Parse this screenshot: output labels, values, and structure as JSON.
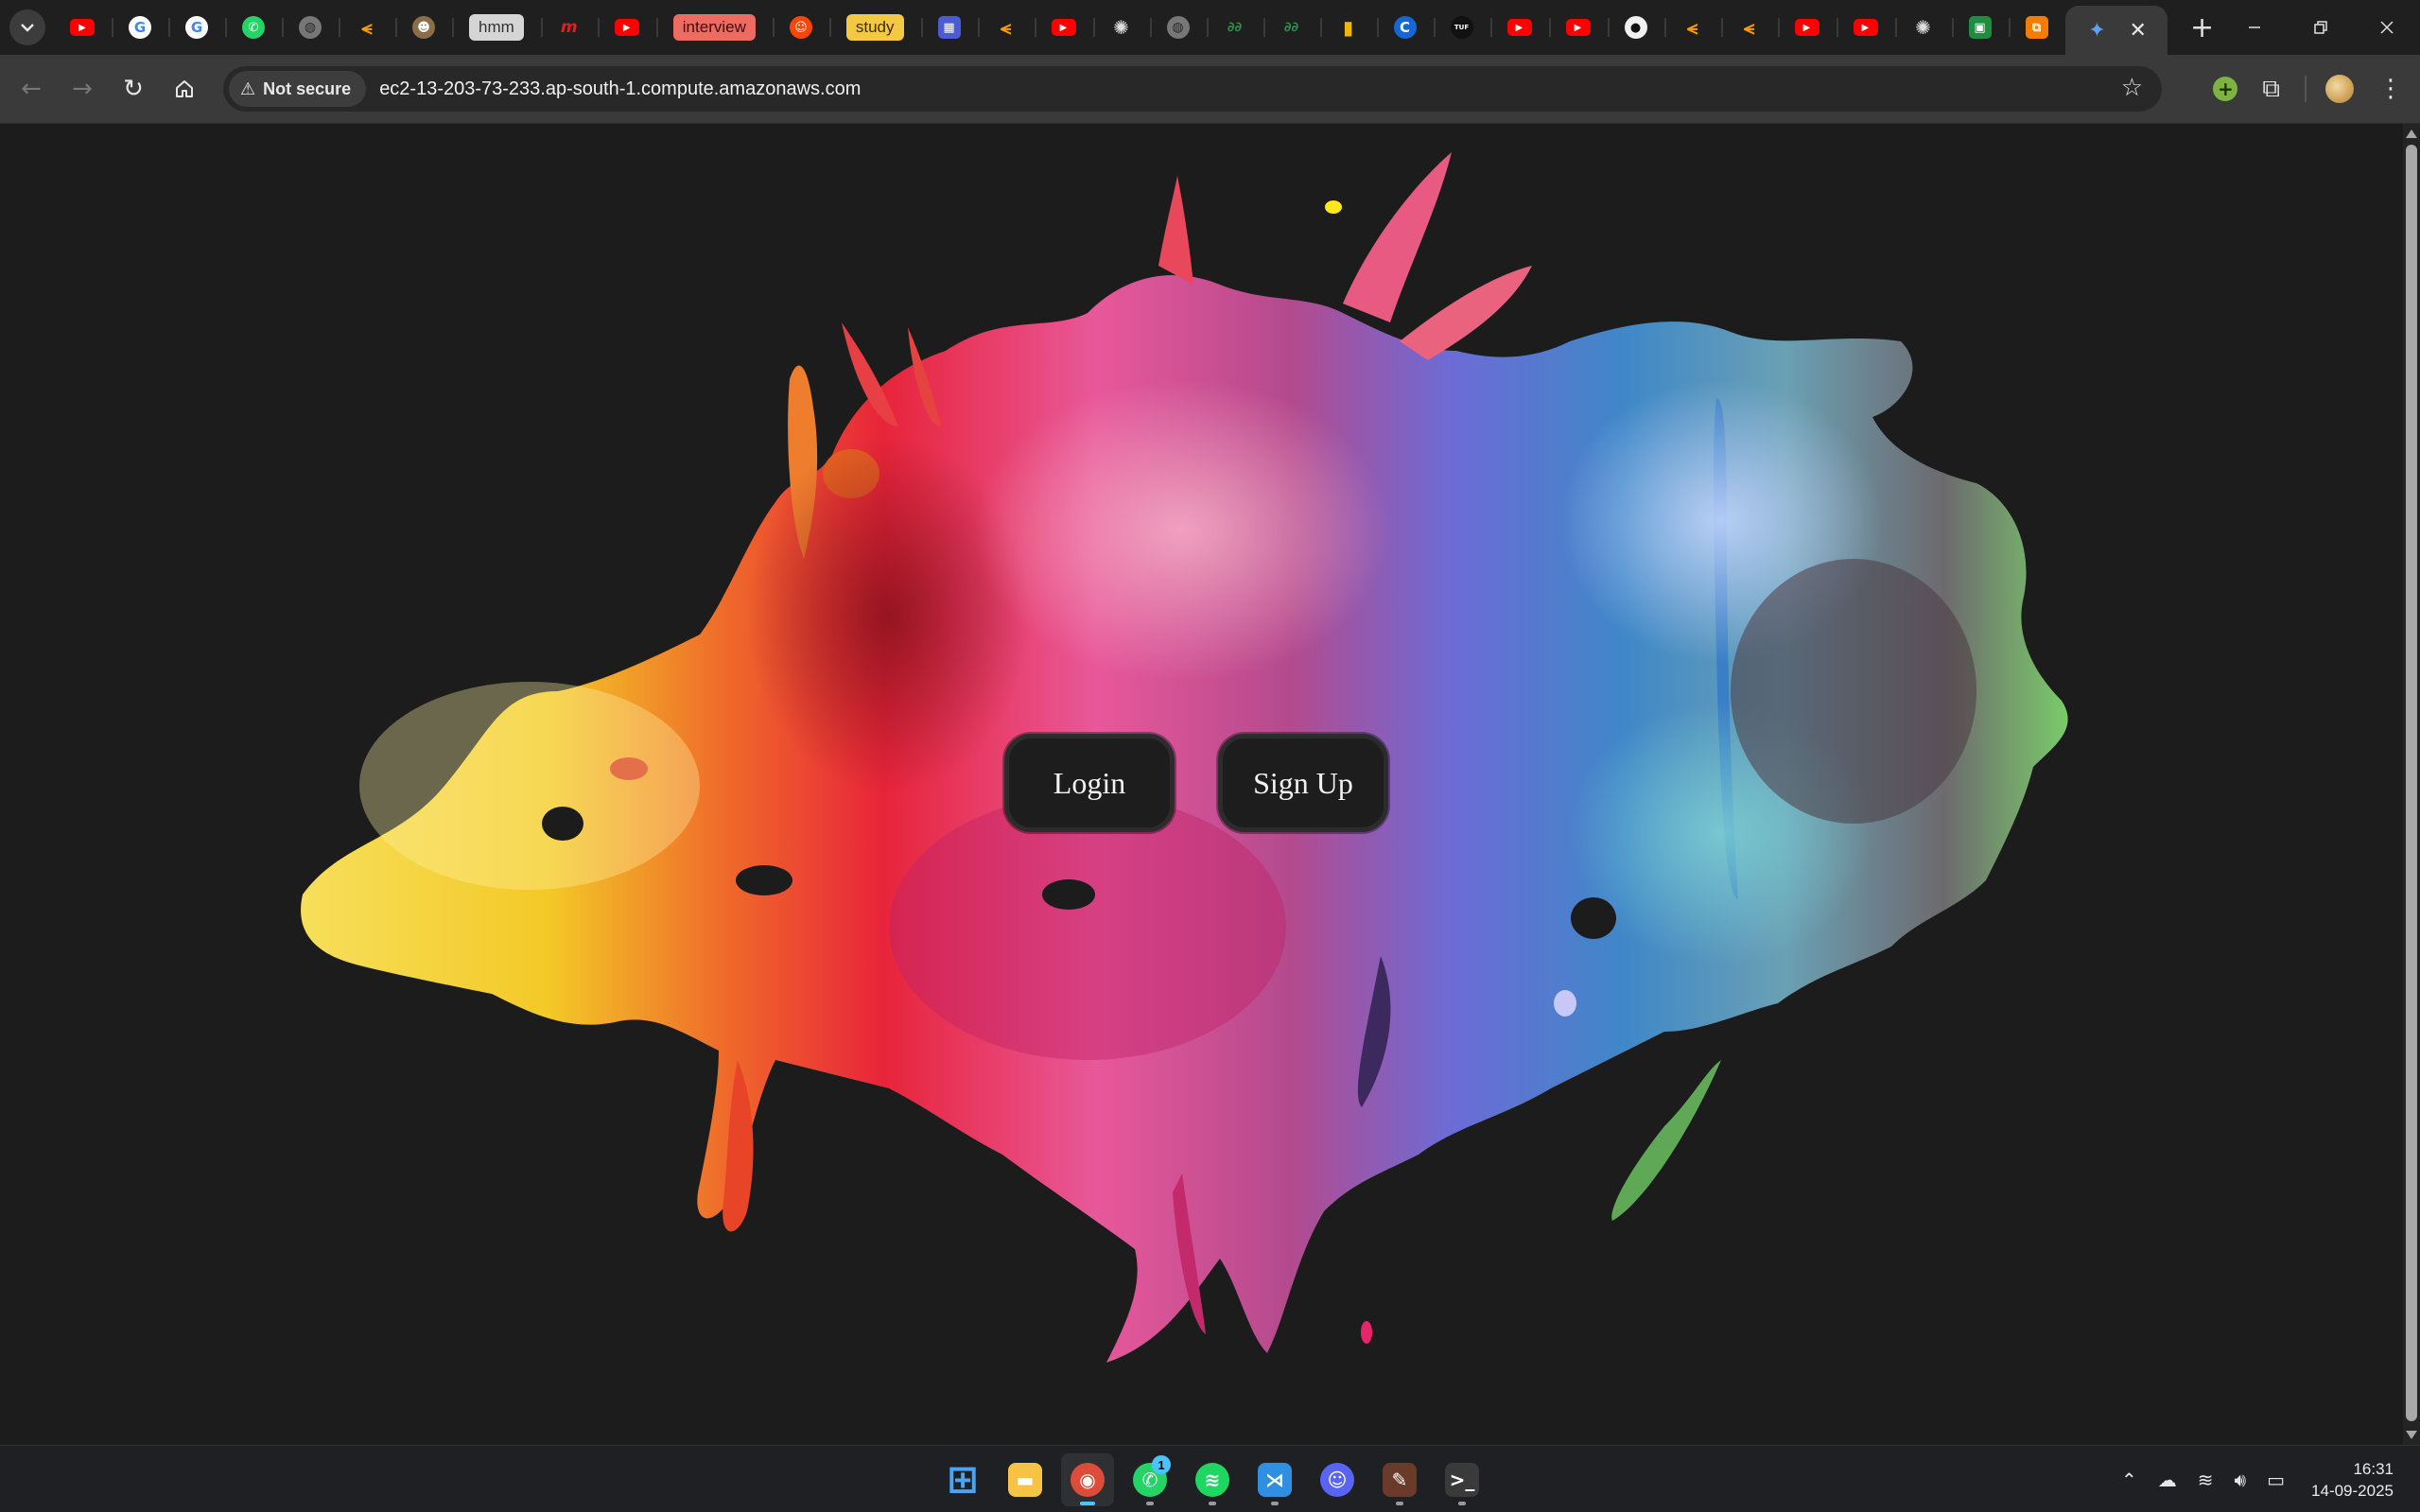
{
  "browser": {
    "tabs": [
      {
        "kind": "icon",
        "icon": "youtube-icon"
      },
      {
        "kind": "icon",
        "icon": "google-icon"
      },
      {
        "kind": "icon",
        "icon": "google-icon"
      },
      {
        "kind": "icon",
        "icon": "whatsapp-icon"
      },
      {
        "kind": "icon",
        "icon": "globe-icon"
      },
      {
        "kind": "icon",
        "icon": "amazon-icon"
      },
      {
        "kind": "icon",
        "icon": "monkey-icon"
      },
      {
        "kind": "chip",
        "label": "hmm",
        "color": "#d5d5d5"
      },
      {
        "kind": "icon",
        "icon": "myntra-icon"
      },
      {
        "kind": "icon",
        "icon": "youtube-icon"
      },
      {
        "kind": "chip",
        "label": "interview",
        "color": "#ee6b61"
      },
      {
        "kind": "icon",
        "icon": "reddit-icon"
      },
      {
        "kind": "chip",
        "label": "study",
        "color": "#f3c843"
      },
      {
        "kind": "icon",
        "icon": "board-icon"
      },
      {
        "kind": "icon",
        "icon": "amazon-icon"
      },
      {
        "kind": "icon",
        "icon": "youtube-icon"
      },
      {
        "kind": "icon",
        "icon": "openai-icon"
      },
      {
        "kind": "icon",
        "icon": "globe-icon"
      },
      {
        "kind": "icon",
        "icon": "geeksforgeeks-icon"
      },
      {
        "kind": "icon",
        "icon": "geeksforgeeks-icon"
      },
      {
        "kind": "icon",
        "icon": "bar-chart-icon"
      },
      {
        "kind": "icon",
        "icon": "c-icon"
      },
      {
        "kind": "icon",
        "icon": "tuf-icon"
      },
      {
        "kind": "icon",
        "icon": "youtube-icon"
      },
      {
        "kind": "icon",
        "icon": "youtube-icon"
      },
      {
        "kind": "icon",
        "icon": "github-icon"
      },
      {
        "kind": "icon",
        "icon": "amazon-icon"
      },
      {
        "kind": "icon",
        "icon": "amazon-icon"
      },
      {
        "kind": "icon",
        "icon": "youtube-icon"
      },
      {
        "kind": "icon",
        "icon": "youtube-icon"
      },
      {
        "kind": "icon",
        "icon": "openai-icon"
      },
      {
        "kind": "icon",
        "icon": "classroom-icon"
      },
      {
        "kind": "icon",
        "icon": "orange-app-icon"
      },
      {
        "kind": "icon",
        "icon": "gemini-icon",
        "active": true
      }
    ],
    "new_tab_symbol": "+",
    "security_label": "Not secure",
    "url": "ec2-13-203-73-233.ap-south-1.compute.amazonaws.com"
  },
  "page": {
    "login_label": "Login",
    "signup_label": "Sign Up",
    "background_color": "#1c1c1c"
  },
  "taskbar": {
    "apps": [
      {
        "name": "start",
        "icon": "windows-start-icon",
        "color": "#4aa4f0"
      },
      {
        "name": "file-explorer",
        "icon": "folder-icon",
        "color": "#f6c344"
      },
      {
        "name": "chrome",
        "icon": "chrome-icon",
        "color": "#dd4b39",
        "active": true
      },
      {
        "name": "whatsapp",
        "icon": "whatsapp-icon",
        "color": "#25d366",
        "badge": "1"
      },
      {
        "name": "spotify",
        "icon": "spotify-icon",
        "color": "#1ed760"
      },
      {
        "name": "vscode",
        "icon": "vscode-icon",
        "color": "#2f8fe0"
      },
      {
        "name": "discord",
        "icon": "discord-icon",
        "color": "#5865f2"
      },
      {
        "name": "tool",
        "icon": "pen-tool-icon",
        "color": "#6b3b2a"
      },
      {
        "name": "terminal",
        "icon": "terminal-icon",
        "color": "#3a3a3a"
      }
    ],
    "time": "16:31",
    "date": "14-09-2025"
  }
}
